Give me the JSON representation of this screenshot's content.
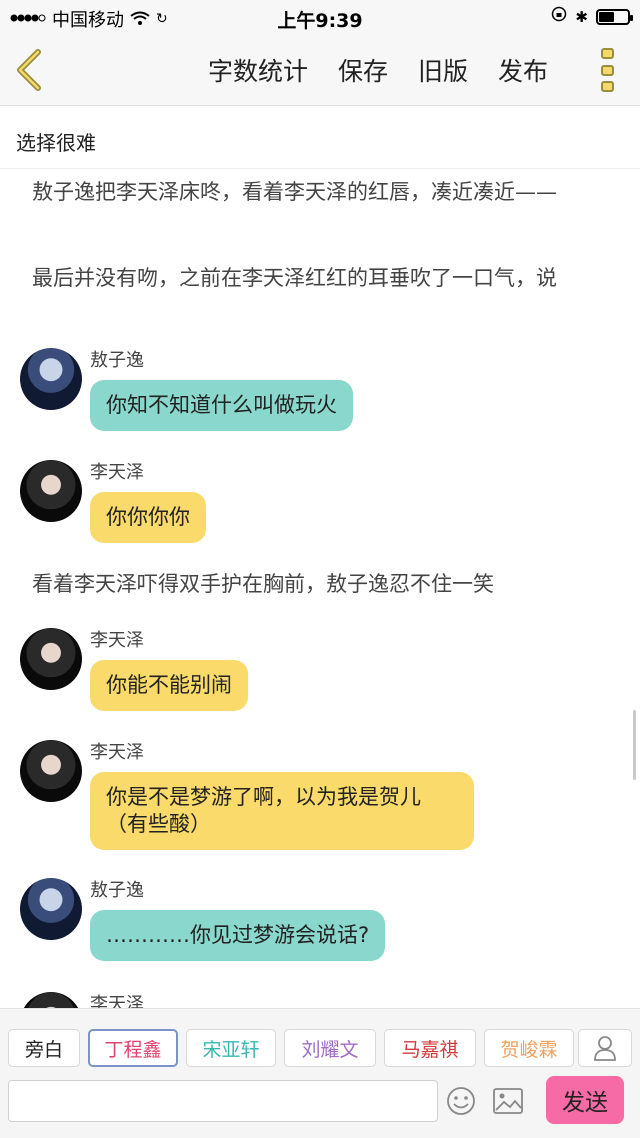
{
  "status_bar": {
    "carrier": "中国移动",
    "time": "上午9:39",
    "battery_level": 0.55
  },
  "nav": {
    "actions": [
      "字数统计",
      "保存",
      "旧版",
      "发布"
    ],
    "icons": {
      "back": "back-chevron-icon",
      "more": "more-vertical-icon"
    },
    "accent_color": "#f5d96a"
  },
  "story_title": "选择很难",
  "content": {
    "narration_1": "敖子逸把李天泽床咚，看着李天泽的红唇，凑近凑近——",
    "narration_2": "最后并没有吻，之前在李天泽红红的耳垂吹了一口气，说",
    "messages": [
      {
        "sender": "敖子逸",
        "text": "你知不知道什么叫做玩火",
        "color": "#8ad8cd"
      },
      {
        "sender": "李天泽",
        "text": "你你你你",
        "color": "#f9da6a"
      },
      {
        "sender": "李天泽",
        "text": "你能不能别闹",
        "color": "#f9da6a"
      },
      {
        "sender": "李天泽",
        "text": "你是不是梦游了啊，以为我是贺儿（有些酸）",
        "color": "#f9da6a"
      },
      {
        "sender": "敖子逸",
        "text": "…………你见过梦游会说话?",
        "color": "#8ad8cd"
      },
      {
        "sender": "李天泽",
        "text": "",
        "color": "#f9da6a"
      }
    ],
    "narration_3": "看着李天泽吓得双手护在胸前，敖子逸忍不住一笑"
  },
  "roles": {
    "items": [
      {
        "label": "旁白",
        "color": "#222222"
      },
      {
        "label": "丁程鑫",
        "color": "#e0436e"
      },
      {
        "label": "宋亚轩",
        "color": "#3ab8b0"
      },
      {
        "label": "刘耀文",
        "color": "#a06cc9"
      },
      {
        "label": "马嘉祺",
        "color": "#d33a3a"
      },
      {
        "label": "贺峻霖",
        "color": "#f0a060"
      }
    ],
    "active_index": 1
  },
  "input": {
    "placeholder": "",
    "send_label": "发送",
    "send_color": "#f66aa6"
  }
}
